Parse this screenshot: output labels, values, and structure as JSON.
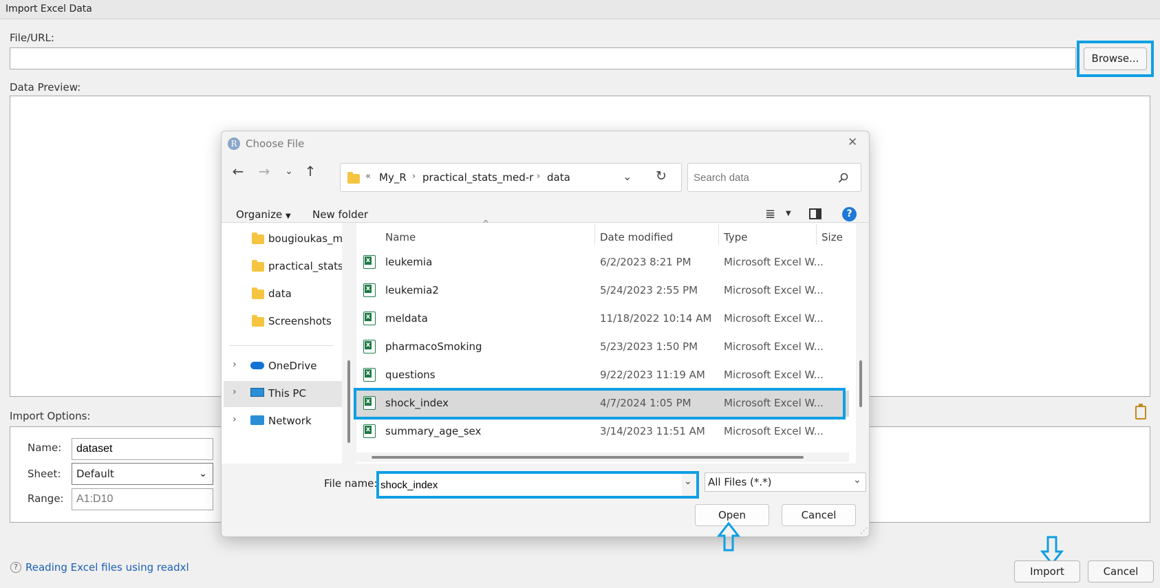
{
  "window": {
    "title": "Import Excel Data",
    "file_url_label": "File/URL:",
    "file_url_value": "",
    "browse_label": "Browse...",
    "data_preview_label": "Data Preview:",
    "import_options_label": "Import Options:",
    "name_label": "Name:",
    "name_value": "dataset",
    "sheet_label": "Sheet:",
    "sheet_value": "Default",
    "range_label": "Range:",
    "range_placeholder": "A1:D10",
    "help_link": "Reading Excel files using readxl",
    "help_icon": "?",
    "import_label": "Import",
    "cancel_label": "Cancel"
  },
  "dialog": {
    "logo": "R",
    "title": "Choose File",
    "close_glyph": "✕",
    "breadcrumb": {
      "overflow": "«",
      "items": [
        "My_R",
        "practical_stats_med-r",
        "data"
      ]
    },
    "search_placeholder": "Search data",
    "toolbar": {
      "organize": "Organize",
      "new_folder": "New folder",
      "help": "?"
    },
    "nav_items": [
      {
        "label": "bougioukas_mu",
        "icon": "folder-icon"
      },
      {
        "label": "practical_stats_n",
        "icon": "folder-icon"
      },
      {
        "label": "data",
        "icon": "folder-icon"
      },
      {
        "label": "Screenshots",
        "icon": "folder-icon"
      }
    ],
    "nav_roots": [
      {
        "label": "OneDrive",
        "icon": "cloud-icon"
      },
      {
        "label": "This PC",
        "icon": "monitor-icon"
      },
      {
        "label": "Network",
        "icon": "network-icon"
      }
    ],
    "columns": {
      "name": "Name",
      "date": "Date modified",
      "type": "Type",
      "size": "Size"
    },
    "files": [
      {
        "name": "leukemia",
        "date": "6/2/2023 8:21 PM",
        "type": "Microsoft Excel W..."
      },
      {
        "name": "leukemia2",
        "date": "5/24/2023 2:55 PM",
        "type": "Microsoft Excel W..."
      },
      {
        "name": "meldata",
        "date": "11/18/2022 10:14 AM",
        "type": "Microsoft Excel W..."
      },
      {
        "name": "pharmacoSmoking",
        "date": "5/23/2023 1:50 PM",
        "type": "Microsoft Excel W..."
      },
      {
        "name": "questions",
        "date": "9/22/2023 11:19 AM",
        "type": "Microsoft Excel W..."
      },
      {
        "name": "shock_index",
        "date": "4/7/2024 1:05 PM",
        "type": "Microsoft Excel W...",
        "selected": true
      },
      {
        "name": "summary_age_sex",
        "date": "3/14/2023 11:51 AM",
        "type": "Microsoft Excel W..."
      }
    ],
    "file_name_label": "File name:",
    "file_name_value": "shock_index",
    "file_type_value": "All Files (*.*)",
    "open_label": "Open",
    "cancel_label": "Cancel"
  },
  "colors": {
    "highlight": "#0f9fe3",
    "selected_row": "#d9d9d9",
    "link": "#1a5fb4"
  }
}
